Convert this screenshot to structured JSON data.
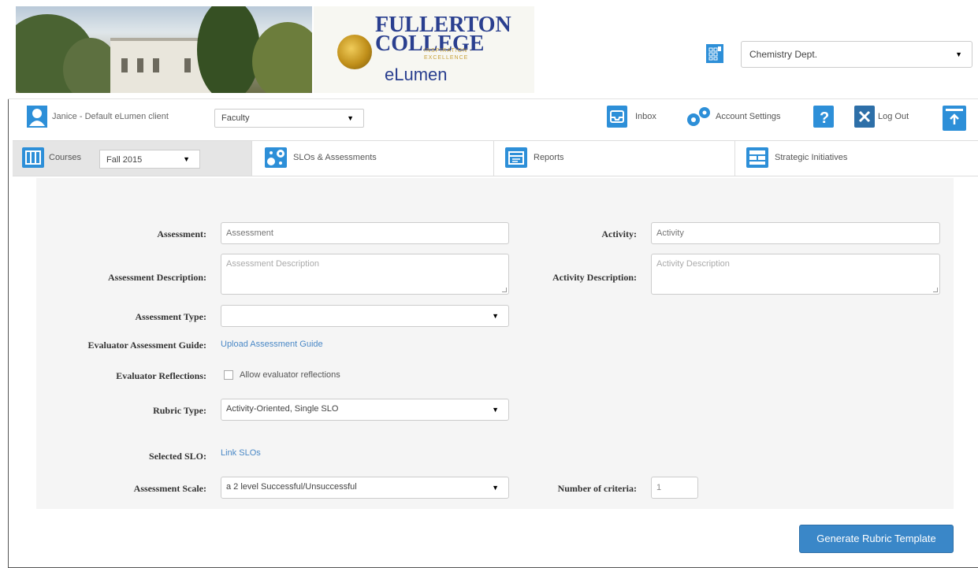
{
  "header": {
    "logo": {
      "line1": "FULLERTON",
      "line2": "COLLEGE",
      "tagline": "INSPIRATION · EXCELLENCE",
      "product": "eLumen"
    },
    "department_select": {
      "value": "Chemistry Dept.",
      "icon": "grid-icon"
    }
  },
  "userbar": {
    "user_name": "Janice - Default eLumen client",
    "role_select": "Faculty",
    "inbox_label": "Inbox",
    "account_settings_label": "Account Settings",
    "logout_label": "Log Out"
  },
  "tabs": [
    {
      "label": "Courses",
      "term": "Fall 2015"
    },
    {
      "label": "SLOs & Assessments"
    },
    {
      "label": "Reports"
    },
    {
      "label": "Strategic Initiatives"
    }
  ],
  "form": {
    "assessment": {
      "label": "Assessment:",
      "placeholder": "Assessment"
    },
    "activity": {
      "label": "Activity:",
      "placeholder": "Activity"
    },
    "assessment_description": {
      "label": "Assessment Description:",
      "placeholder": "Assessment Description"
    },
    "activity_description": {
      "label": "Activity Description:",
      "placeholder": "Activity Description"
    },
    "assessment_type": {
      "label": "Assessment Type:",
      "value": ""
    },
    "evaluator_guide": {
      "label": "Evaluator Assessment Guide:",
      "link": "Upload Assessment Guide"
    },
    "evaluator_reflections": {
      "label": "Evaluator Reflections:",
      "checkbox_label": "Allow evaluator reflections",
      "checked": false
    },
    "rubric_type": {
      "label": "Rubric Type:",
      "value": "Activity-Oriented, Single SLO"
    },
    "selected_slo": {
      "label": "Selected SLO:",
      "link": "Link SLOs"
    },
    "assessment_scale": {
      "label": "Assessment Scale:",
      "value": "a 2 level Successful/Unsuccessful"
    },
    "number_of_criteria": {
      "label": "Number of criteria:",
      "value": "1"
    }
  },
  "actions": {
    "generate_label": "Generate Rubric Template"
  },
  "colors": {
    "accent": "#2d8fd8",
    "button": "#3a87c8",
    "link": "#4a88c6",
    "panel": "#f5f5f5"
  }
}
